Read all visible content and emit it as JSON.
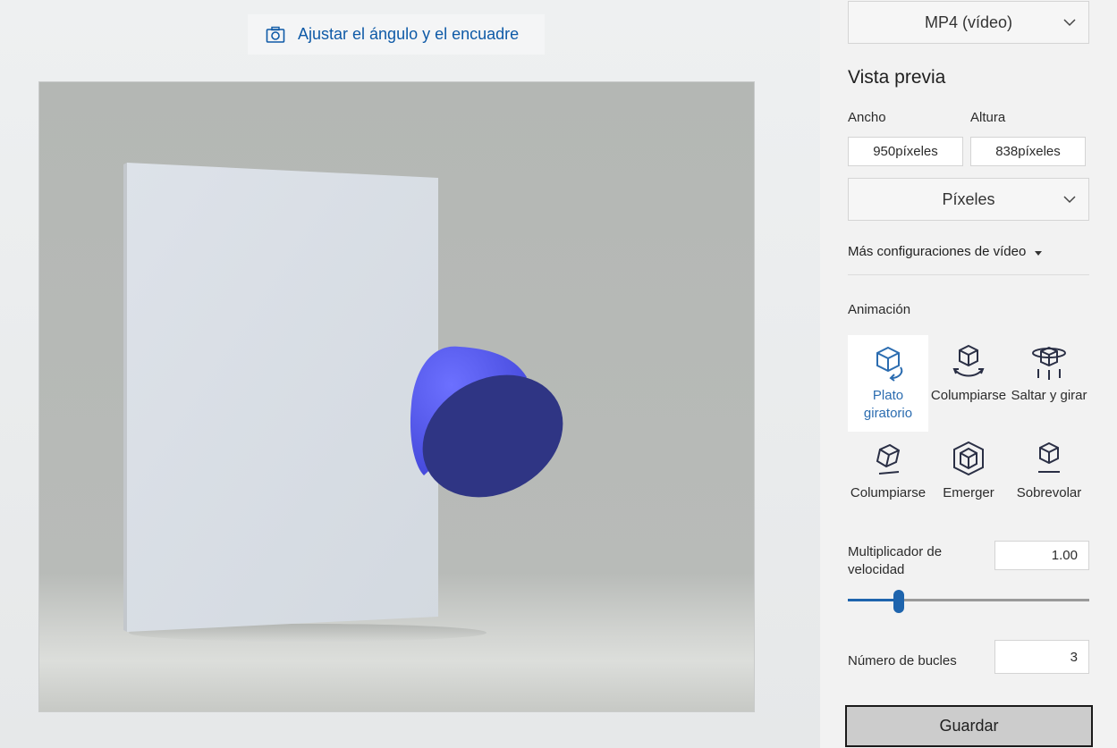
{
  "canvas": {
    "adjust_button_label": "Ajustar el ángulo y el encuadre",
    "shape_color": "#2f3584",
    "shape_highlight_color": "#5a5ff5"
  },
  "format_dropdown": {
    "value": "MP4 (vídeo)"
  },
  "preview": {
    "title": "Vista previa",
    "width_label": "Ancho",
    "height_label": "Altura",
    "width_value": "950píxeles",
    "height_value": "838píxeles",
    "units_dropdown": "Píxeles",
    "more_settings": "Más configuraciones de vídeo"
  },
  "animation": {
    "title": "Animación",
    "items": [
      {
        "label": "Plato giratorio",
        "icon": "turntable-icon",
        "selected": true
      },
      {
        "label": "Columpiarse",
        "icon": "swing-icon",
        "selected": false
      },
      {
        "label": "Saltar y girar",
        "icon": "jump-turn-icon",
        "selected": false
      },
      {
        "label": "Columpiarse",
        "icon": "wobble-icon",
        "selected": false
      },
      {
        "label": "Emerger",
        "icon": "emerge-icon",
        "selected": false
      },
      {
        "label": "Sobrevolar",
        "icon": "float-icon",
        "selected": false
      }
    ]
  },
  "speed": {
    "label": "Multiplicador de velocidad",
    "value": "1.00",
    "slider_fraction": 0.21
  },
  "loops": {
    "label": "Número de bucles",
    "value": "3"
  },
  "save_button": "Guardar",
  "colors": {
    "accent": "#1e64ad",
    "link_blue": "#0e5aa7"
  }
}
